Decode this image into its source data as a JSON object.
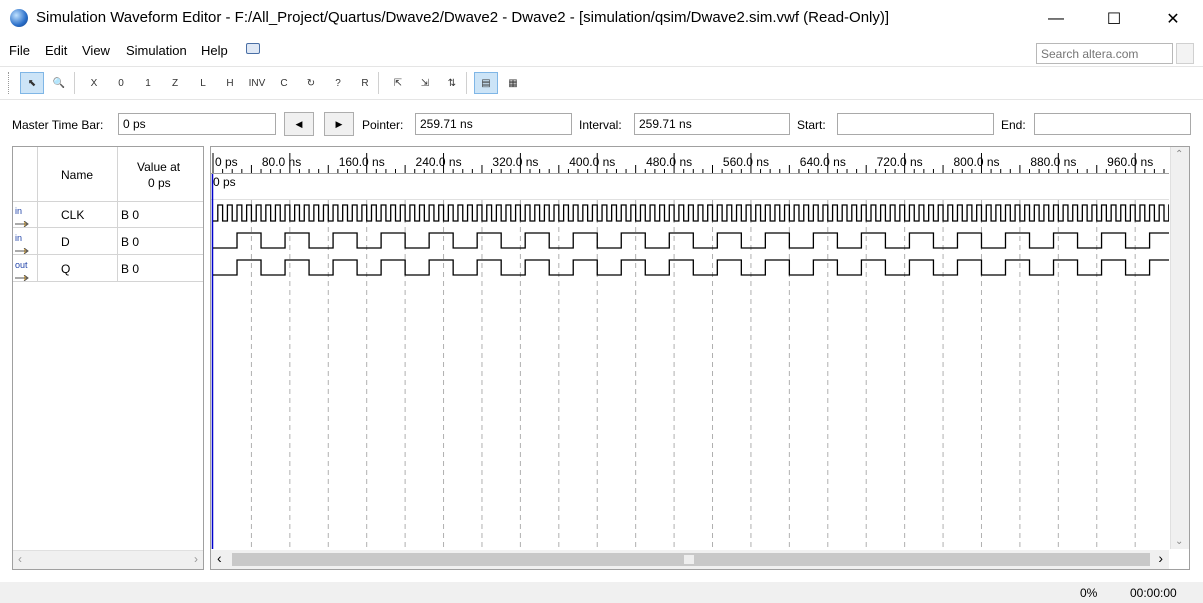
{
  "window": {
    "title": "Simulation Waveform Editor - F:/All_Project/Quartus/Dwave2/Dwave2 - Dwave2 - [simulation/qsim/Dwave2.sim.vwf (Read-Only)]",
    "minimize_icon": "minimize-icon",
    "maximize_icon": "maximize-icon",
    "close_icon": "close-icon"
  },
  "menu": {
    "items": [
      {
        "label": "File"
      },
      {
        "label": "Edit"
      },
      {
        "label": "View"
      },
      {
        "label": "Simulation"
      },
      {
        "label": "Help"
      }
    ],
    "search_placeholder": "Search altera.com"
  },
  "toolbar": {
    "buttons": [
      {
        "icon": "selection-tool-icon",
        "glyph": "⬉",
        "active": true
      },
      {
        "icon": "zoom-tool-icon",
        "glyph": "🔍"
      },
      {
        "icon": "forcing-unknown-icon",
        "glyph": "X"
      },
      {
        "icon": "forcing-low-icon",
        "glyph": "0"
      },
      {
        "icon": "forcing-high-icon",
        "glyph": "1"
      },
      {
        "icon": "high-impedance-icon",
        "glyph": "Z"
      },
      {
        "icon": "weak-low-icon",
        "glyph": "L"
      },
      {
        "icon": "weak-high-icon",
        "glyph": "H"
      },
      {
        "icon": "invert-icon",
        "glyph": "INV"
      },
      {
        "icon": "count-value-icon",
        "glyph": "C"
      },
      {
        "icon": "overwrite-clock-icon",
        "glyph": "↻"
      },
      {
        "icon": "random-values-icon",
        "glyph": "?"
      },
      {
        "icon": "arbitrary-value-icon",
        "glyph": "R"
      },
      {
        "icon": "snap-to-grid-icon",
        "glyph": "⇱"
      },
      {
        "icon": "group-icon",
        "glyph": "⇲"
      },
      {
        "icon": "sort-icon",
        "glyph": "⇅"
      },
      {
        "icon": "insert-time-bar-icon",
        "glyph": "▤",
        "active": true
      },
      {
        "icon": "grid-settings-icon",
        "glyph": "▦"
      }
    ]
  },
  "timebar": {
    "master_label": "Master Time Bar:",
    "master_value": "0 ps",
    "prev_label": "◀",
    "next_label": "▶",
    "pointer_label": "Pointer:",
    "pointer_value": "259.71 ns",
    "interval_label": "Interval:",
    "interval_value": "259.71 ns",
    "start_label": "Start:",
    "start_value": "",
    "end_label": "End:",
    "end_value": ""
  },
  "signals": {
    "header_name": "Name",
    "header_value_line1": "Value at",
    "header_value_line2": "0 ps",
    "rows": [
      {
        "direction": "in",
        "name": "CLK",
        "value": "B 0"
      },
      {
        "direction": "in",
        "name": "D",
        "value": "B 0"
      },
      {
        "direction": "out",
        "name": "Q",
        "value": "B 0"
      }
    ]
  },
  "waveform": {
    "time_axis": [
      "0 ps",
      "80.0 ns",
      "160.0 ns",
      "240.0 ns",
      "320.0 ns",
      "400.0 ns",
      "480.0 ns",
      "560.0 ns",
      "640.0 ns",
      "720.0 ns",
      "800.0 ns",
      "880.0 ns",
      "960.0 ns"
    ],
    "axis_step_ns": 80,
    "visible_end_ns": 1000,
    "cursor_label": "0 ps",
    "clk_period_ns": 10,
    "d_period_ns": 50,
    "q_period_ns": 50,
    "colors": {
      "cursor": "#0000cc",
      "signal": "#000000",
      "grid": "#b0b0b0"
    }
  },
  "status": {
    "progress": "0%",
    "elapsed": "00:00:00"
  }
}
